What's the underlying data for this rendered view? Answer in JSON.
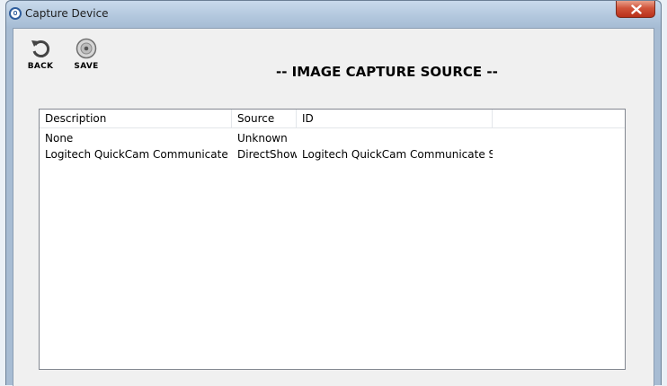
{
  "window": {
    "title": "Capture Device",
    "close_glyph": "×"
  },
  "toolbar": {
    "back_label": "BACK",
    "save_label": "SAVE"
  },
  "heading": "-- IMAGE CAPTURE SOURCE --",
  "list": {
    "columns": [
      "Description",
      "Source",
      "ID"
    ],
    "rows": [
      {
        "description": "None",
        "source": "Unknown",
        "id": ""
      },
      {
        "description": "Logitech QuickCam Communicate STX",
        "source": "DirectShow",
        "id": "Logitech QuickCam Communicate STX"
      }
    ]
  },
  "icons": {
    "app": "app-icon",
    "back": "back-arrow-icon",
    "save": "disc-icon",
    "close": "close-icon"
  }
}
